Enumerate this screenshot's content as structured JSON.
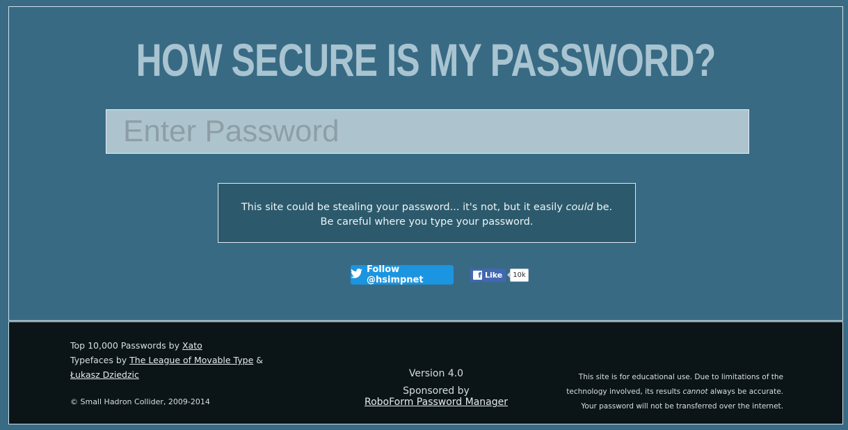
{
  "title": "HOW SECURE IS MY PASSWORD?",
  "password_input": {
    "placeholder": "Enter Password",
    "value": ""
  },
  "notice": {
    "line1_pre": "This site could be stealing your password... it's not, but it easily ",
    "line1_em": "could",
    "line1_post": " be.",
    "line2": "Be careful where you type your password."
  },
  "social": {
    "twitter_label": "Follow @hsimpnet",
    "facebook_label": "Like",
    "facebook_count": "10k"
  },
  "footer": {
    "line1_pre": "Top 10,000 Passwords by ",
    "line1_link": "Xato",
    "line2_pre": "Typefaces by ",
    "line2_link": "The League of Movable Type",
    "line2_post": " &",
    "line3_link": "Łukasz Dziedzic",
    "copyright": "© Small Hadron Collider, 2009-2014",
    "version": "Version 4.0",
    "sponsored": "Sponsored by",
    "sponsor_link": "RoboForm Password Manager",
    "disclaimer_l1": "This site is for educational use. Due to limitations of the",
    "disclaimer_l2_pre": "technology involved, its results ",
    "disclaimer_l2_em": "cannot",
    "disclaimer_l2_post": " always be accurate.",
    "disclaimer_l3": "Your password will not be transferred over the internet."
  }
}
